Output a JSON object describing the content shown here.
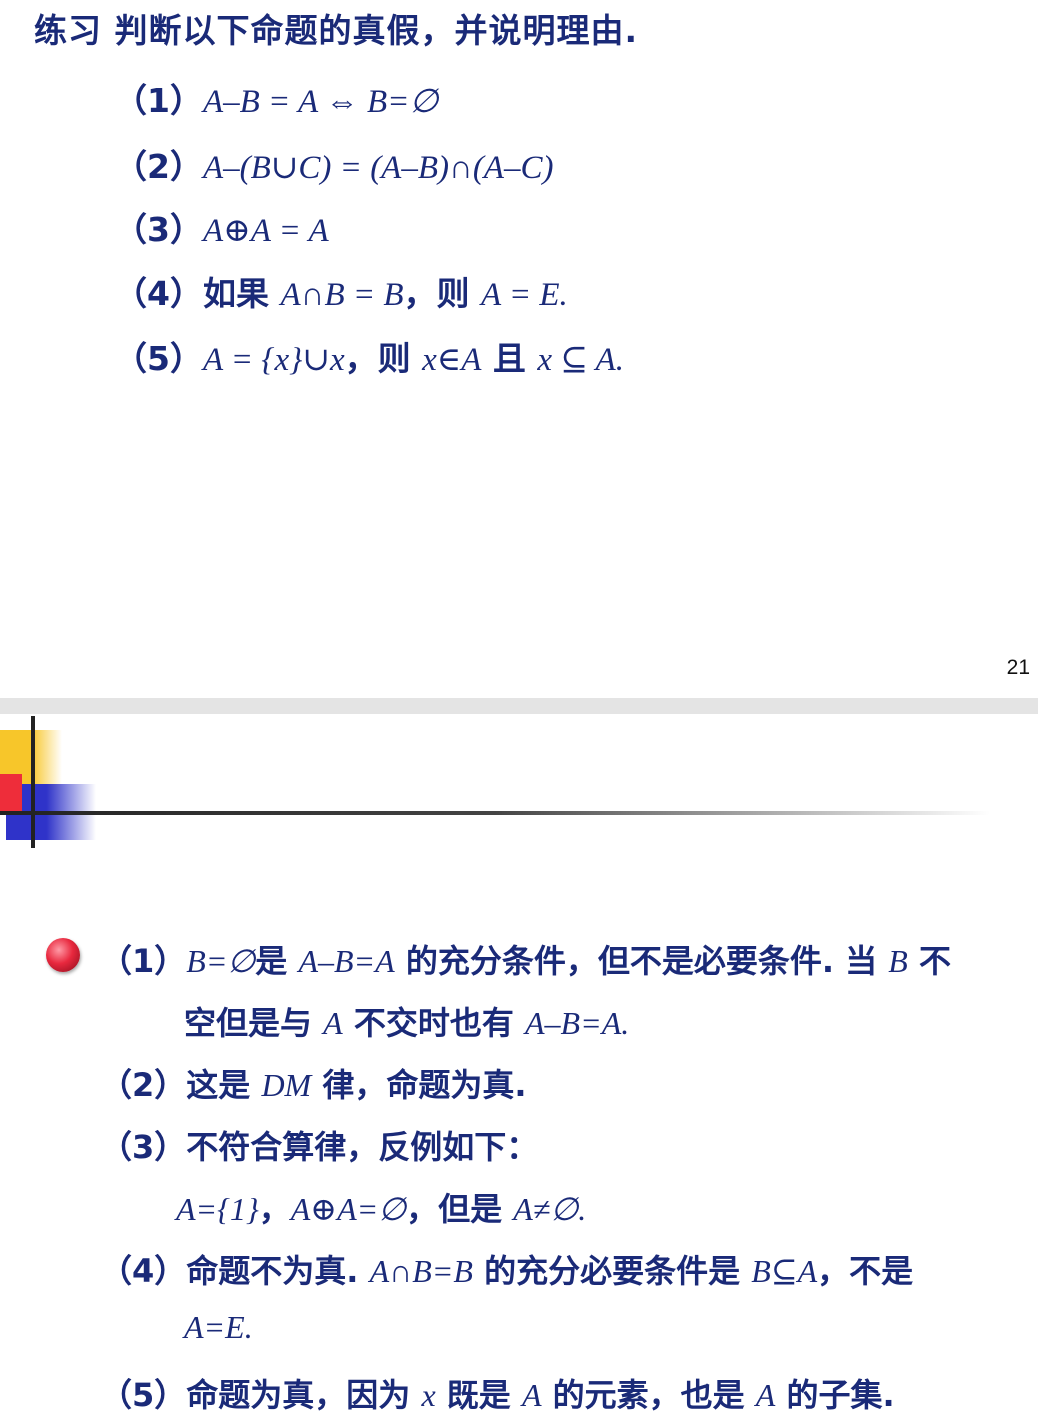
{
  "slide1": {
    "title": "练习 判断以下命题的真假，并说明理由.",
    "items": [
      {
        "num": "（1）",
        "math1": "A–B = A ⇔ B=∅",
        "cn": "",
        "math2": "",
        "cn2": "",
        "math3": "",
        "cn3": "",
        "math4": ""
      },
      {
        "num": "（2）",
        "math1": "A–(B∪C) = (A–B)∩(A–C)",
        "cn": "",
        "math2": "",
        "cn2": "",
        "math3": "",
        "cn3": "",
        "math4": ""
      },
      {
        "num": "（3）",
        "math1": "A⊕A = A",
        "cn": "",
        "math2": "",
        "cn2": "",
        "math3": "",
        "cn3": "",
        "math4": ""
      },
      {
        "num": "（4）",
        "math1": "",
        "cn": "如果 ",
        "math2": "A∩B = B",
        "cn2": "，则 ",
        "math3": "A = E.",
        "cn3": "",
        "math4": ""
      },
      {
        "num": "（5）",
        "math1": "A = {x}∪x",
        "cn": "，则 ",
        "math2": "x∈A",
        "cn2": " 且 ",
        "math3": "x ⊆ A.",
        "cn3": "",
        "math4": ""
      }
    ],
    "page_number": "21"
  },
  "slide2": {
    "answers": {
      "a1_line1": {
        "num": "（1）",
        "p1": "B=∅",
        "p2": "是 ",
        "p3": "A–B=A",
        "p4": " 的充分条件，但不是必要条件. 当 ",
        "p5": "B",
        "p6": " 不"
      },
      "a1_line2": {
        "p1": "空但是与 ",
        "p2": "A",
        "p3": " 不交时也有 ",
        "p4": "A–B=A."
      },
      "a2": {
        "num": "（2）",
        "p1": "这是 ",
        "p2": "DM",
        "p3": " 律，命题为真."
      },
      "a3": {
        "num": "（3）",
        "p1": "不符合算律，反例如下："
      },
      "a3_line2": {
        "p1": "A={1}",
        "p2": "，",
        "p3": "A⊕A=∅",
        "p4": "，但是 ",
        "p5": "A≠∅."
      },
      "a4": {
        "num": "（4）",
        "p1": "命题不为真. ",
        "p2": "A∩B=B",
        "p3": " 的充分必要条件是 ",
        "p4": "B⊆A",
        "p5": "，不是"
      },
      "a4_line2": {
        "p1": "A=E."
      },
      "a5": {
        "num": "（5）",
        "p1": "命题为真，因为 ",
        "p2": "x",
        "p3": " 既是 ",
        "p4": "A",
        "p5": " 的元素，也是 ",
        "p6": "A",
        "p7": " 的子集."
      }
    },
    "bullet_icon": "red-ball-bullet-icon"
  },
  "colors": {
    "text": "#1a2a78",
    "accent_yellow": "#f7c62a",
    "accent_red": "#ee2d3a",
    "accent_blue": "#2f33c9"
  }
}
